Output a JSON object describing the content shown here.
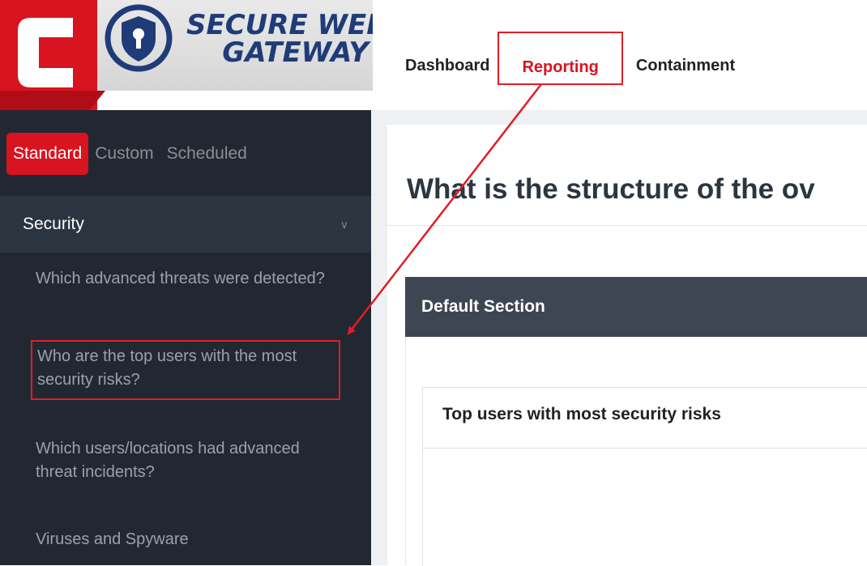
{
  "brand": {
    "line1": "SECURE WEB",
    "line2": "GATEWAY",
    "red": "#d7141f",
    "navy": "#1f3c78"
  },
  "topnav": {
    "items": [
      {
        "label": "Dashboard"
      },
      {
        "label": "Reporting"
      },
      {
        "label": "Containment"
      }
    ]
  },
  "sidebar": {
    "tabs": [
      {
        "label": "Standard"
      },
      {
        "label": "Custom"
      },
      {
        "label": "Scheduled"
      }
    ],
    "section_label": "Security",
    "items": [
      {
        "label": "Which advanced threats were detected?"
      },
      {
        "label": "Who are the top users with the most security risks?"
      },
      {
        "label": "Which users/locations had advanced threat incidents?"
      },
      {
        "label": "Viruses and Spyware"
      }
    ]
  },
  "main": {
    "question_title": "What is the structure of the ov",
    "section_header": "Default Section",
    "report_title": "Top users with most security risks"
  },
  "annotation": {
    "color": "#e11d26"
  }
}
